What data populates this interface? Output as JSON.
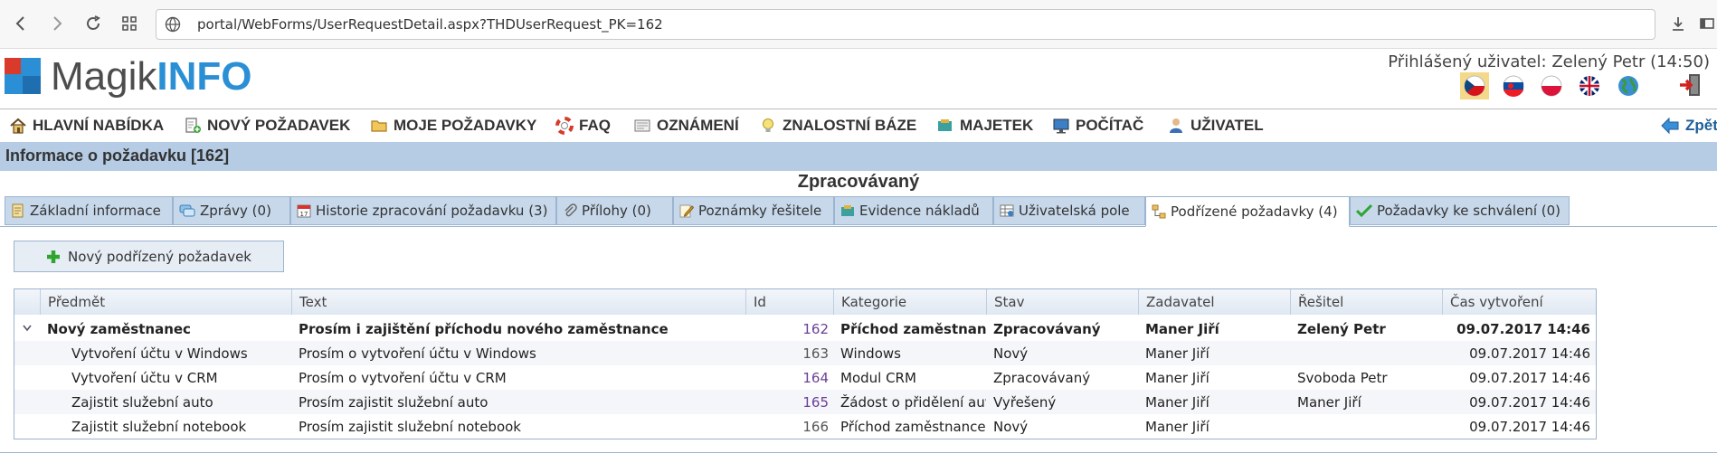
{
  "browser": {
    "url": "portal/WebForms/UserRequestDetail.aspx?THDUserRequest_PK=162"
  },
  "header": {
    "logo_a": "Magik",
    "logo_b": "INFO",
    "logged_user": "Přihlášený uživatel: Zelený Petr (14:50)"
  },
  "menu": [
    {
      "label": "HLAVNÍ NABÍDKA"
    },
    {
      "label": "NOVÝ POŽADAVEK"
    },
    {
      "label": "MOJE POŽADAVKY"
    },
    {
      "label": "FAQ"
    },
    {
      "label": "OZNÁMENÍ"
    },
    {
      "label": "ZNALOSTNÍ BÁZE"
    },
    {
      "label": "MAJETEK"
    },
    {
      "label": "POČÍTAČ"
    },
    {
      "label": "UŽIVATEL"
    }
  ],
  "back_label": "Zpět",
  "page": {
    "title": "Informace o požadavku [162]",
    "status": "Zpracovávaný"
  },
  "tabs": [
    {
      "label": "Základní informace"
    },
    {
      "label": "Zprávy (0)"
    },
    {
      "label": "Historie zpracování požadavku (3)"
    },
    {
      "label": "Přílohy (0)"
    },
    {
      "label": "Poznámky řešitele"
    },
    {
      "label": "Evidence nákladů"
    },
    {
      "label": "Uživatelská pole"
    },
    {
      "label": "Podřízené požadavky (4)"
    },
    {
      "label": "Požadavky ke schválení (0)"
    }
  ],
  "new_button": "Nový podřízený požadavek",
  "table": {
    "columns": [
      "Předmět",
      "Text",
      "Id",
      "Kategorie",
      "Stav",
      "Zadavatel",
      "Řešitel",
      "Čas vytvoření"
    ],
    "rows": [
      {
        "subject": "Nový zaměstnanec",
        "text": "Prosím i zajištění příchodu nového zaměstnance",
        "id": "162",
        "category": "Příchod zaměstnance",
        "state": "Zpracovávaný",
        "requester": "Maner Jiří",
        "solver": "Zelený Petr",
        "created": "09.07.2017 14:46"
      },
      {
        "subject": "Vytvoření účtu v Windows",
        "text": "Prosím o vytvoření účtu v Windows",
        "id": "163",
        "category": "Windows",
        "state": "Nový",
        "requester": "Maner Jiří",
        "solver": "",
        "created": "09.07.2017 14:46"
      },
      {
        "subject": "Vytvoření účtu v CRM",
        "text": "Prosím o vytvoření účtu v CRM",
        "id": "164",
        "category": "Modul CRM",
        "state": "Zpracovávaný",
        "requester": "Maner Jiří",
        "solver": "Svoboda Petr",
        "created": "09.07.2017 14:46"
      },
      {
        "subject": "Zajistit služební auto",
        "text": "Prosím zajistit služební auto",
        "id": "165",
        "category": "Žádost o přidělení auta",
        "state": "Vyřešený",
        "requester": "Maner Jiří",
        "solver": "Maner Jiří",
        "created": "09.07.2017 14:46"
      },
      {
        "subject": "Zajistit služební notebook",
        "text": "Prosím zajistit služební notebook",
        "id": "166",
        "category": "Příchod zaměstnance",
        "state": "Nový",
        "requester": "Maner Jiří",
        "solver": "",
        "created": "09.07.2017 14:46"
      }
    ]
  }
}
